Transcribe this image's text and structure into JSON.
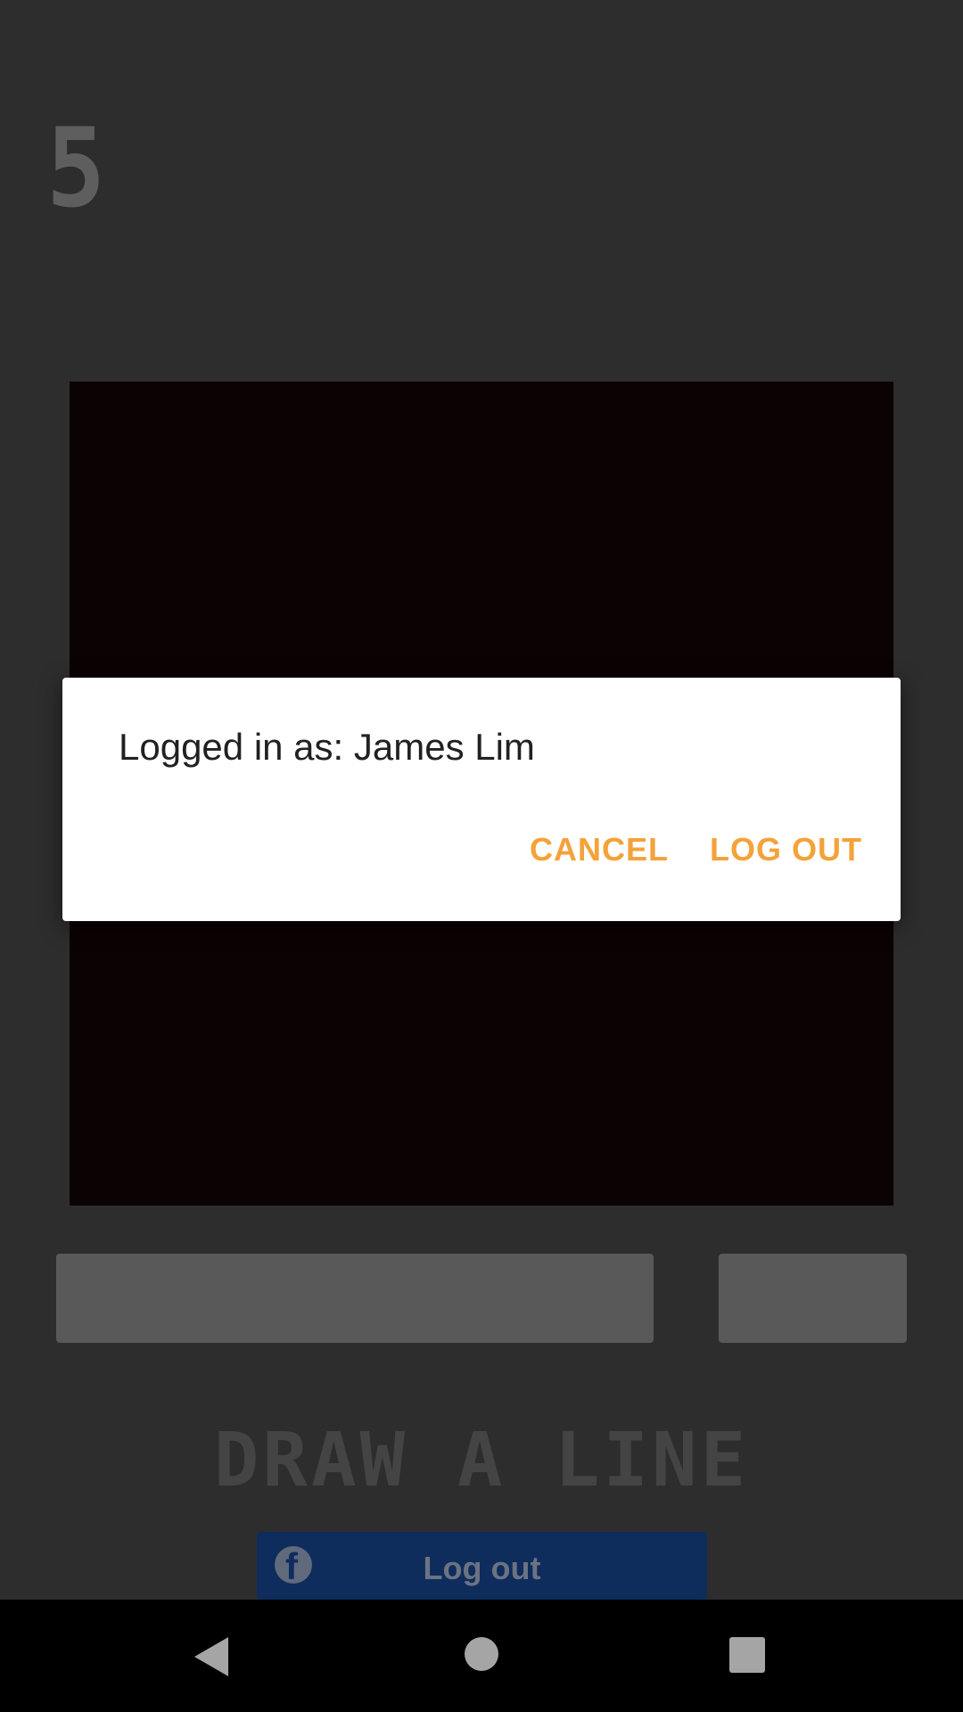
{
  "game": {
    "score": "5",
    "title": "DRAW A LINE"
  },
  "facebook_button": {
    "icon": "facebook-icon",
    "label": "Log out"
  },
  "dialog": {
    "message": "Logged in as: James Lim",
    "cancel_label": "CANCEL",
    "logout_label": "LOG OUT",
    "accent_color": "#f4a23a"
  },
  "nav_bar": {
    "back_icon": "back-triangle-icon",
    "home_icon": "home-circle-icon",
    "recents_icon": "recents-square-icon"
  }
}
